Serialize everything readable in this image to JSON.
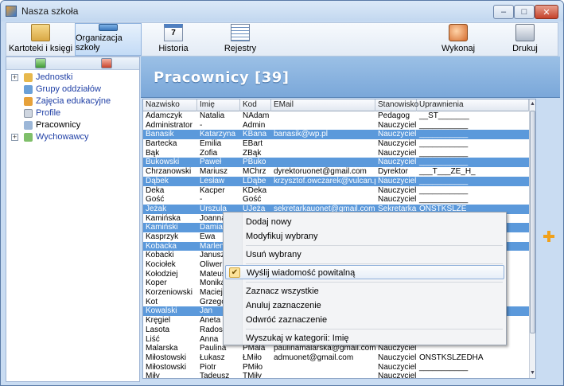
{
  "window": {
    "title": "Nasza szkoła",
    "controls": [
      "–",
      "□",
      "✕"
    ]
  },
  "toolbar": {
    "items": [
      {
        "label": "Kartoteki i księgi",
        "icon": "folder-icon"
      },
      {
        "label": "Organizacja szkoły",
        "icon": "school-icon",
        "active": true
      },
      {
        "label": "Historia",
        "icon": "calendar-icon",
        "glyph": "7"
      },
      {
        "label": "Rejestry",
        "icon": "list-icon"
      },
      {
        "label": "Wykonaj",
        "icon": "run-icon"
      },
      {
        "label": "Drukuj",
        "icon": "printer-icon"
      }
    ]
  },
  "sidebar": {
    "tree": [
      {
        "label": "Jednostki",
        "expander": "+",
        "icon": "units-icon"
      },
      {
        "label": "Grupy oddziałów",
        "icon": "groups-icon"
      },
      {
        "label": "Zajęcia edukacyjne",
        "icon": "classes-icon"
      },
      {
        "label": "Profile",
        "icon": "profile-icon"
      },
      {
        "label": "Pracownicy",
        "icon": "staff-icon",
        "selected": true
      },
      {
        "label": "Wychowawcy",
        "expander": "+",
        "icon": "tutors-icon"
      }
    ]
  },
  "main": {
    "heading": "Pracownicy [39]",
    "columns": [
      "Nazwisko",
      "Imię",
      "Kod",
      "EMail",
      "Stanowisko",
      "Uprawnienia"
    ],
    "rows": [
      {
        "selected": false,
        "cells": [
          "Adamczyk",
          "Natalia",
          "NAdam",
          "",
          "Pedagog",
          "__ST_______"
        ]
      },
      {
        "selected": false,
        "cells": [
          "Administrator",
          "-",
          "Admin",
          "",
          "Nauczyciel",
          "___________"
        ]
      },
      {
        "selected": true,
        "cells": [
          "Banasik",
          "Katarzyna",
          "KBana",
          "banasik@wp.pl",
          "Nauczyciel",
          "___________"
        ]
      },
      {
        "selected": false,
        "cells": [
          "Bartecka",
          "Emilia",
          "EBart",
          "",
          "Nauczyciel",
          "___________"
        ]
      },
      {
        "selected": false,
        "cells": [
          "Bąk",
          "Zofia",
          "ZBąk",
          "",
          "Nauczyciel",
          "___________"
        ]
      },
      {
        "selected": true,
        "cells": [
          "Bukowski",
          "Paweł",
          "PBuko",
          "",
          "Nauczyciel",
          "___________"
        ]
      },
      {
        "selected": false,
        "cells": [
          "Chrzanowski",
          "Mariusz",
          "MChrz",
          "dyrektoruonet@gmail.com",
          "Dyrektor",
          "___T___ZE_H_"
        ]
      },
      {
        "selected": true,
        "cells": [
          "Dąbek",
          "Lesław",
          "LDąbe",
          "krzysztof.owczarek@vulcan.pl",
          "Nauczyciel",
          "___________"
        ]
      },
      {
        "selected": false,
        "cells": [
          "Deka",
          "Kacper",
          "KDeka",
          "",
          "Nauczyciel",
          "___________"
        ]
      },
      {
        "selected": false,
        "cells": [
          "Gość",
          "-",
          "Gość",
          "",
          "Nauczyciel",
          "___________"
        ]
      },
      {
        "selected": true,
        "cells": [
          "Jeżak",
          "Urszula",
          "UJeża",
          "sekretarkauonet@gmail.com",
          "Sekretarka",
          "ONSTKSLZE"
        ]
      },
      {
        "selected": false,
        "cells": [
          "Kamińska",
          "Joanna",
          "",
          "",
          "",
          ""
        ]
      },
      {
        "selected": true,
        "cells": [
          "Kamiński",
          "Damian",
          "",
          "",
          "",
          ""
        ]
      },
      {
        "selected": false,
        "cells": [
          "Kasprzyk",
          "Ewa",
          "",
          "",
          "",
          ""
        ]
      },
      {
        "selected": true,
        "cells": [
          "Kobacka",
          "Marlena",
          "",
          "",
          "",
          ""
        ]
      },
      {
        "selected": false,
        "cells": [
          "Kobacki",
          "Janusz",
          "",
          "",
          "",
          ""
        ]
      },
      {
        "selected": false,
        "cells": [
          "Kociołek",
          "Oliwer",
          "",
          "",
          "",
          ""
        ]
      },
      {
        "selected": false,
        "cells": [
          "Kołodziej",
          "Mateusz",
          "",
          "",
          "",
          ""
        ]
      },
      {
        "selected": false,
        "cells": [
          "Koper",
          "Monika",
          "",
          "",
          "",
          ""
        ]
      },
      {
        "selected": false,
        "cells": [
          "Korzeniowski",
          "Maciej",
          "",
          "",
          "",
          ""
        ]
      },
      {
        "selected": false,
        "cells": [
          "Kot",
          "Grzegorz",
          "",
          "",
          "",
          ""
        ]
      },
      {
        "selected": true,
        "cells": [
          "Kowalski",
          "Jan",
          "",
          "",
          "",
          ""
        ]
      },
      {
        "selected": false,
        "cells": [
          "Kręgiel",
          "Aneta",
          "",
          "",
          "",
          ""
        ]
      },
      {
        "selected": false,
        "cells": [
          "Lasota",
          "Radosław",
          "",
          "",
          "",
          ""
        ]
      },
      {
        "selected": false,
        "cells": [
          "Liść",
          "Anna",
          "",
          "",
          "",
          ""
        ]
      },
      {
        "selected": false,
        "cells": [
          "Malarska",
          "Paulina",
          "PMala",
          "paulinamalarska@gmail.com",
          "Nauczyciel",
          ""
        ]
      },
      {
        "selected": false,
        "cells": [
          "Miłostowski",
          "Łukasz",
          "ŁMiło",
          "admuonet@gmail.com",
          "Nauczyciel",
          "ONSTKSLZEDHA"
        ]
      },
      {
        "selected": false,
        "cells": [
          "Miłostowski",
          "Piotr",
          "PMiło",
          "",
          "Nauczyciel",
          "___________"
        ]
      },
      {
        "selected": false,
        "cells": [
          "Miły",
          "Tadeusz",
          "TMiły",
          "",
          "Nauczyciel",
          "___________"
        ]
      }
    ]
  },
  "context_menu": {
    "items": [
      {
        "label": "Dodaj nowy"
      },
      {
        "label": "Modyfikuj wybrany"
      },
      {
        "label": "Usuń wybrany"
      },
      {
        "label": "Wyślij wiadomość powitalną",
        "highlighted": true,
        "checked": true
      },
      {
        "label": "Zaznacz wszystkie"
      },
      {
        "label": "Anuluj zaznaczenie"
      },
      {
        "label": "Odwróć zaznaczenie"
      },
      {
        "label": "Wyszukaj w kategorii: Imię"
      }
    ]
  },
  "colors": {
    "selection": "#5b99db",
    "banner": "#7aa7d9",
    "accent_plus": "#f0a11c"
  }
}
